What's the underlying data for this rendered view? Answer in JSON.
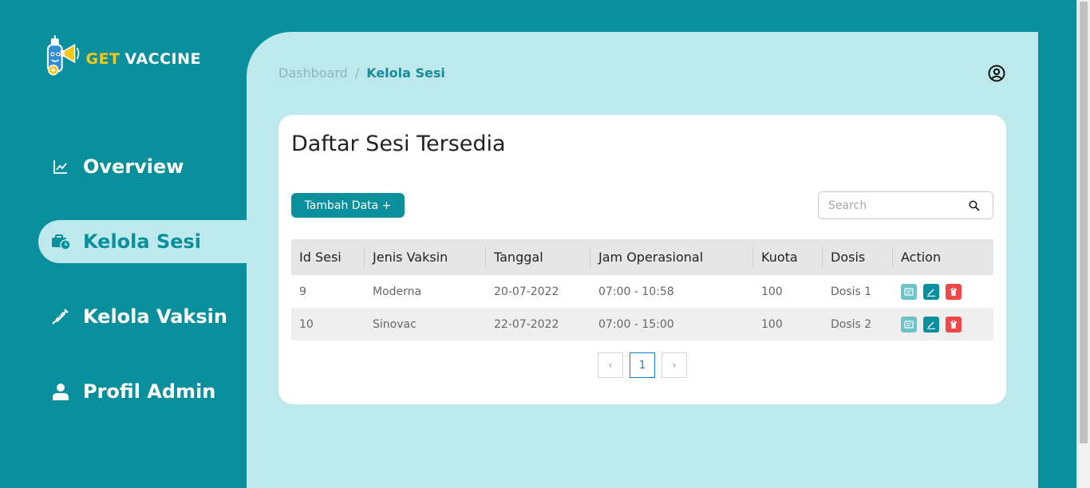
{
  "brand": {
    "get": "GET",
    "vaccine": "VACCINE"
  },
  "sidebar": {
    "items": [
      {
        "label": "Overview",
        "icon": "line-chart-icon",
        "active": false
      },
      {
        "label": "Kelola Sesi",
        "icon": "briefcase-clock-icon",
        "active": true
      },
      {
        "label": "Kelola Vaksin",
        "icon": "syringe-icon",
        "active": false
      },
      {
        "label": "Profil Admin",
        "icon": "user-icon",
        "active": false
      }
    ]
  },
  "breadcrumb": {
    "home": "Dashboard",
    "separator": "/",
    "current": "Kelola Sesi"
  },
  "card": {
    "title": "Daftar Sesi Tersedia",
    "add_button": "Tambah Data +",
    "search_placeholder": "Search"
  },
  "table": {
    "headers": [
      "Id Sesi",
      "Jenis Vaksin",
      "Tanggal",
      "Jam Operasional",
      "Kuota",
      "Dosis",
      "Action"
    ],
    "rows": [
      [
        "9",
        "Moderna",
        "20-07-2022",
        "07:00 - 10:58",
        "100",
        "Dosis 1"
      ],
      [
        "10",
        "Sinovac",
        "22-07-2022",
        "07:00 - 15:00",
        "100",
        "Dosis 2"
      ]
    ]
  },
  "pagination": {
    "prev": "‹",
    "current": "1",
    "next": "›"
  },
  "colors": {
    "primary": "#0a8f9c",
    "panel": "#bde8ec",
    "view": "#6ec3c9",
    "delete": "#f04848",
    "brand_yellow": "#f5c81a"
  }
}
